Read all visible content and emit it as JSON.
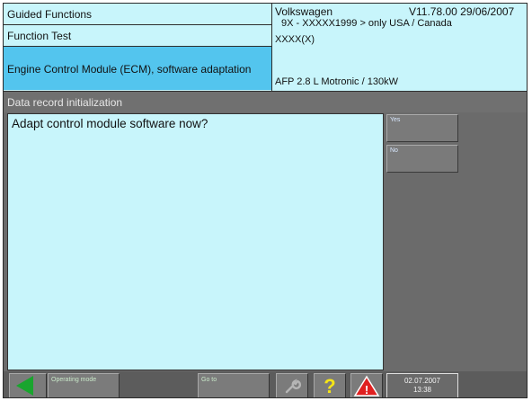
{
  "header": {
    "nav_1": "Guided Functions",
    "nav_2": "Function Test",
    "nav_3": "Engine Control Module (ECM), software adaptation",
    "make": "Volkswagen",
    "version": "V11.78.00 29/06/2007",
    "model_range": "9X - XXXXX1999 > only USA / Canada",
    "model_code": "XXXX(X)",
    "engine": "AFP 2.8 L Motronic / 130kW"
  },
  "title_bar": "Data record initialization",
  "main": {
    "question": "Adapt control module software now?"
  },
  "side_buttons": {
    "yes": "Yes",
    "no": "No"
  },
  "toolbar": {
    "operating_mode": "Operating mode",
    "go_to": "Go to",
    "clock_date": "02.07.2007",
    "clock_time": "13:38"
  },
  "colors": {
    "panel_bg": "#c8f5fb",
    "selected_bg": "#53c5ee",
    "screen_bg": "#6b6b6b",
    "back_arrow": "#19a52e",
    "help": "#f5e516",
    "warning": "#e02020"
  }
}
